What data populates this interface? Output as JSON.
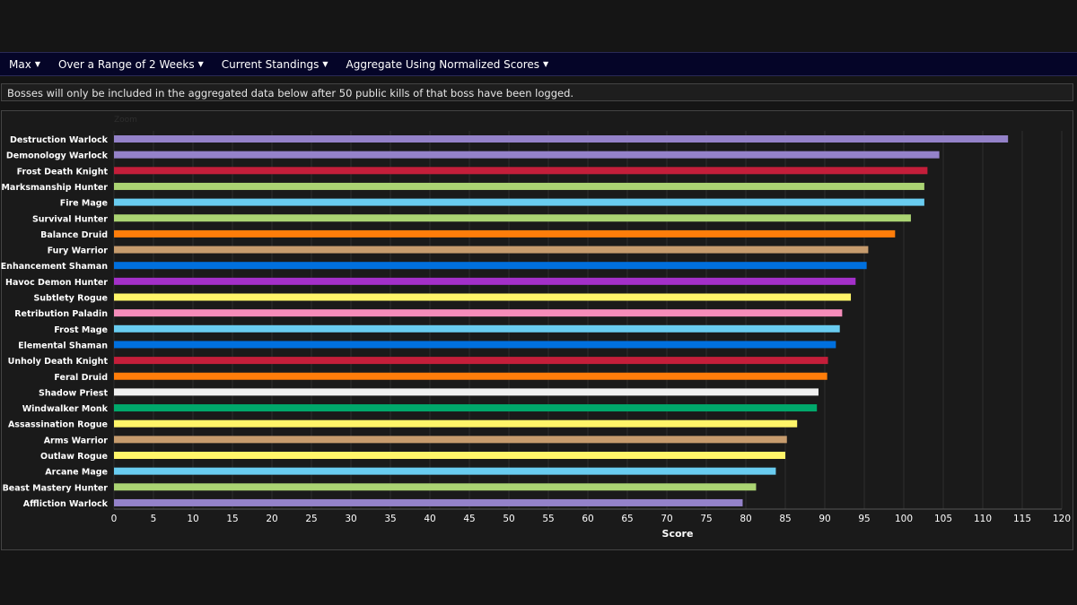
{
  "nav": {
    "items": [
      {
        "label": "Max"
      },
      {
        "label": "Over a Range of 2 Weeks"
      },
      {
        "label": "Current Standings"
      },
      {
        "label": "Aggregate Using Normalized Scores"
      }
    ]
  },
  "notice": {
    "text": "Bosses will only be included in the aggregated data below after 50 public kills of that boss have been logged."
  },
  "zoom_label": "Zoom",
  "chart_data": {
    "type": "bar",
    "orientation": "horizontal",
    "title": "",
    "xlabel": "Score",
    "ylabel": "",
    "xlim": [
      0,
      120
    ],
    "xticks": [
      0,
      5,
      10,
      15,
      20,
      25,
      30,
      35,
      40,
      45,
      50,
      55,
      60,
      65,
      70,
      75,
      80,
      85,
      90,
      95,
      100,
      105,
      110,
      115,
      120
    ],
    "grid": true,
    "categories": [
      "Destruction Warlock",
      "Demonology Warlock",
      "Frost Death Knight",
      "Marksmanship Hunter",
      "Fire Mage",
      "Survival Hunter",
      "Balance Druid",
      "Fury Warrior",
      "Enhancement Shaman",
      "Havoc Demon Hunter",
      "Subtlety Rogue",
      "Retribution Paladin",
      "Frost Mage",
      "Elemental Shaman",
      "Unholy Death Knight",
      "Feral Druid",
      "Shadow Priest",
      "Windwalker Monk",
      "Assassination Rogue",
      "Arms Warrior",
      "Outlaw Rogue",
      "Arcane Mage",
      "Beast Mastery Hunter",
      "Affliction Warlock"
    ],
    "values": [
      113.2,
      104.5,
      103.0,
      102.6,
      102.6,
      100.9,
      98.9,
      95.5,
      95.3,
      93.9,
      93.3,
      92.2,
      91.9,
      91.4,
      90.4,
      90.3,
      89.2,
      89.0,
      86.5,
      85.2,
      85.0,
      83.8,
      81.3,
      79.6
    ],
    "colors": [
      "#9482c9",
      "#9482c9",
      "#c41e3a",
      "#abd473",
      "#69ccf0",
      "#abd473",
      "#ff7d0a",
      "#c79c6e",
      "#0070de",
      "#a330c9",
      "#fff569",
      "#f58cba",
      "#69ccf0",
      "#0070de",
      "#c41e3a",
      "#ff7d0a",
      "#f0f0f0",
      "#00a86b",
      "#fff569",
      "#c79c6e",
      "#fff569",
      "#69ccf0",
      "#abd473",
      "#9482c9"
    ]
  }
}
